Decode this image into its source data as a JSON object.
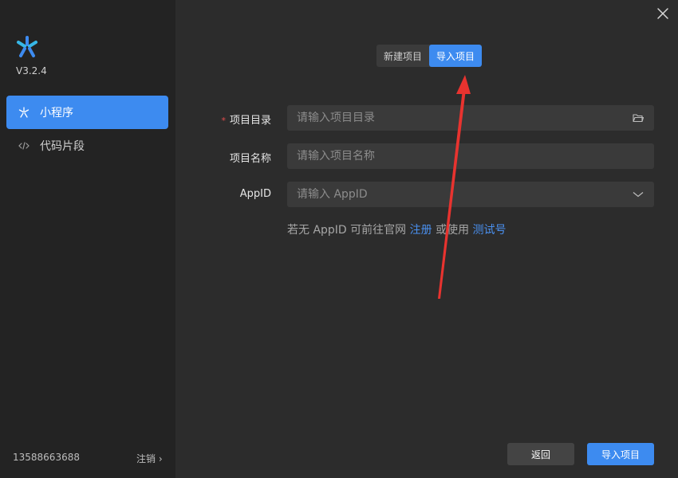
{
  "app": {
    "version": "V3.2.4"
  },
  "sidebar": {
    "items": [
      {
        "label": "小程序",
        "icon": "miniprogram-icon",
        "active": true
      },
      {
        "label": "代码片段",
        "icon": "code-icon",
        "active": false
      }
    ],
    "account": "13588663688",
    "logout_label": "注销 ›"
  },
  "tabs": [
    {
      "label": "新建项目",
      "active": false
    },
    {
      "label": "导入项目",
      "active": true
    }
  ],
  "form": {
    "required_mark": "*",
    "directory": {
      "label": "项目目录",
      "placeholder": "请输入项目目录",
      "value": "",
      "icon": "folder-icon"
    },
    "name": {
      "label": "项目名称",
      "placeholder": "请输入项目名称",
      "value": ""
    },
    "appid": {
      "label": "AppID",
      "placeholder": "请输入 AppID",
      "value": "",
      "icon": "chevron-down-icon"
    }
  },
  "hint": {
    "prefix": "若无 AppID 可前往官网 ",
    "register_link": "注册",
    "middle": " 或使用 ",
    "test_link": "测试号"
  },
  "footer": {
    "back_label": "返回",
    "import_label": "导入项目"
  },
  "colors": {
    "accent": "#3d8bf0",
    "link": "#4a90ef",
    "required": "#e24c4c",
    "annotation_arrow": "#e8332f"
  }
}
